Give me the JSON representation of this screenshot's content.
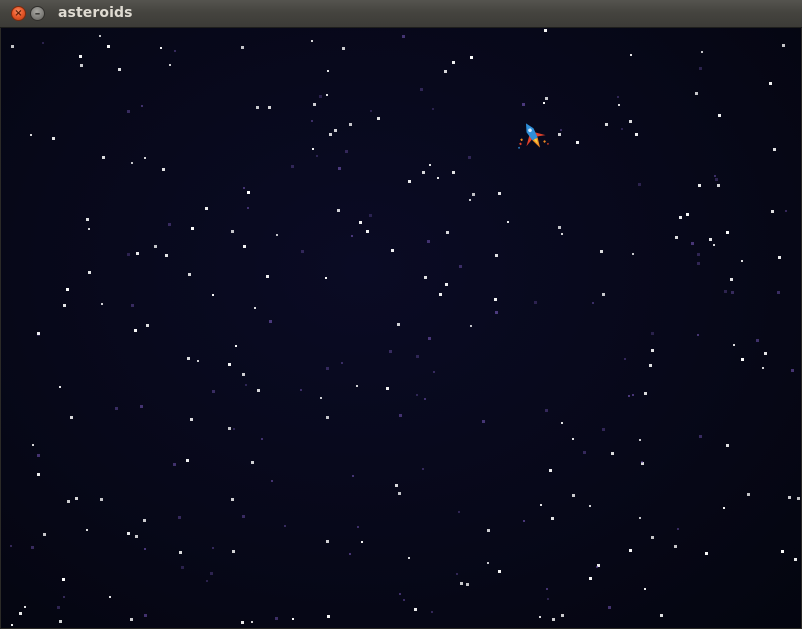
{
  "window": {
    "title": "asteroids",
    "close_glyph": "×",
    "minimize_glyph": "–",
    "close_icon": "close-icon",
    "minimize_icon": "minimize-icon"
  },
  "game": {
    "background_color": "#070819",
    "star_color": "#ffffff",
    "dim_star_color": "#6a4fa8",
    "ship_icon": "spaceship-icon",
    "ship_colors": [
      "#2e8fd8",
      "#e0402a",
      "#f08a24",
      "#f5d040"
    ]
  }
}
